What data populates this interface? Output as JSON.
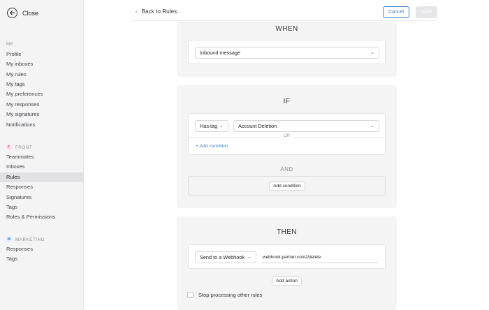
{
  "sidebar": {
    "close_label": "Close",
    "sections": {
      "me": {
        "heading": "ME",
        "items": [
          "Profile",
          "My inboxes",
          "My rules",
          "My tags",
          "My preferences",
          "My responses",
          "My signatures",
          "Notifications"
        ]
      },
      "front": {
        "badge": "F",
        "heading": "FRONT",
        "items": [
          "Teammates",
          "Inboxes",
          "Rules",
          "Responses",
          "Signatures",
          "Tags",
          "Roles & Permissions"
        ]
      },
      "marketing": {
        "badge": "M",
        "heading": "MARKETING",
        "items": [
          "Responses",
          "Tags"
        ]
      }
    },
    "active_item": "Rules"
  },
  "topbar": {
    "back_label": "Back to Rules",
    "cancel_label": "Cancel",
    "save_label": "Save"
  },
  "when": {
    "title": "WHEN",
    "trigger_value": "Inbound message"
  },
  "if": {
    "title": "IF",
    "condition_type": "Has tag",
    "condition_value": "Account Deletion",
    "or_label": "OR",
    "add_condition_link": "+ Add condition",
    "and_label": "AND",
    "add_condition_button": "Add condition"
  },
  "then": {
    "title": "THEN",
    "action_type": "Send to a Webhook",
    "webhook_url": "webhook.partner.co/v2/delete",
    "add_action_button": "Add action",
    "stop_processing_label": "Stop processing other rules",
    "stop_processing_checked": false
  },
  "colors": {
    "accent": "#3d7fd6",
    "sidebar_bg": "#f4f4f5",
    "panel_bg": "#f4f4f5"
  }
}
